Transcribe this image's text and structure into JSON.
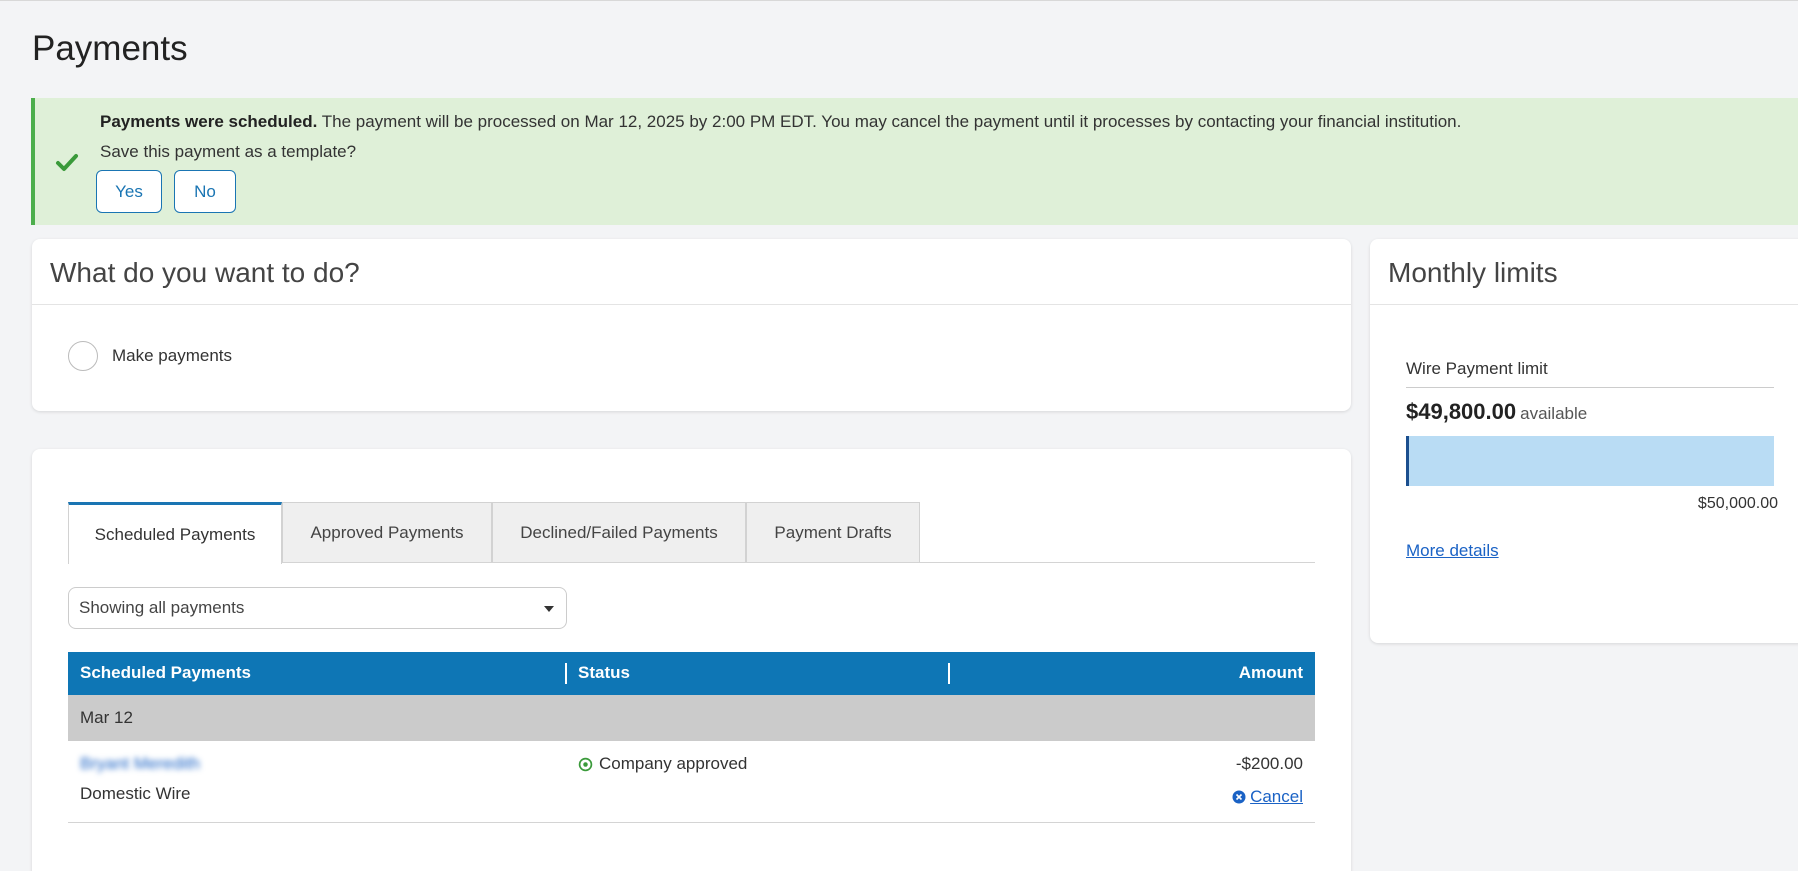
{
  "page": {
    "title": "Payments"
  },
  "banner": {
    "title": "Payments were scheduled.",
    "message": " The payment will be processed on Mar 12, 2025 by 2:00 PM EDT. You may cancel the payment until it processes by contacting your financial institution.",
    "question": "Save this payment as a template?",
    "yes_label": "Yes",
    "no_label": "No",
    "icon": "check-icon",
    "accent_color": "#4cae4c",
    "background_color": "#dff0d8"
  },
  "todo": {
    "title": "What do you want to do?",
    "options": [
      {
        "label": "Make payments",
        "selected": false
      }
    ]
  },
  "limits": {
    "title": "Monthly limits",
    "label": "Wire Payment limit",
    "available_amount": "$49,800.00",
    "available_suffix": "available",
    "max_amount": "$50,000.00",
    "used_fraction": 0.004,
    "more_link": "More details"
  },
  "payments": {
    "tabs": [
      {
        "label": "Scheduled Payments",
        "active": true
      },
      {
        "label": "Approved Payments",
        "active": false
      },
      {
        "label": "Declined/Failed Payments",
        "active": false
      },
      {
        "label": "Payment Drafts",
        "active": false
      }
    ],
    "filter": {
      "selected": "Showing all payments",
      "icon": "caret-down-icon"
    },
    "table": {
      "headers": [
        "Scheduled Payments",
        "Status",
        "Amount"
      ],
      "header_color": "#0e76b5",
      "groups": [
        {
          "date": "Mar 12",
          "rows": [
            {
              "payee": "Bryant Meredith",
              "type": "Domestic Wire",
              "status": "Company approved",
              "status_icon": "circle-check-icon",
              "amount": "-$200.00",
              "action": "Cancel",
              "action_icon": "circle-x-icon"
            }
          ]
        }
      ]
    }
  }
}
